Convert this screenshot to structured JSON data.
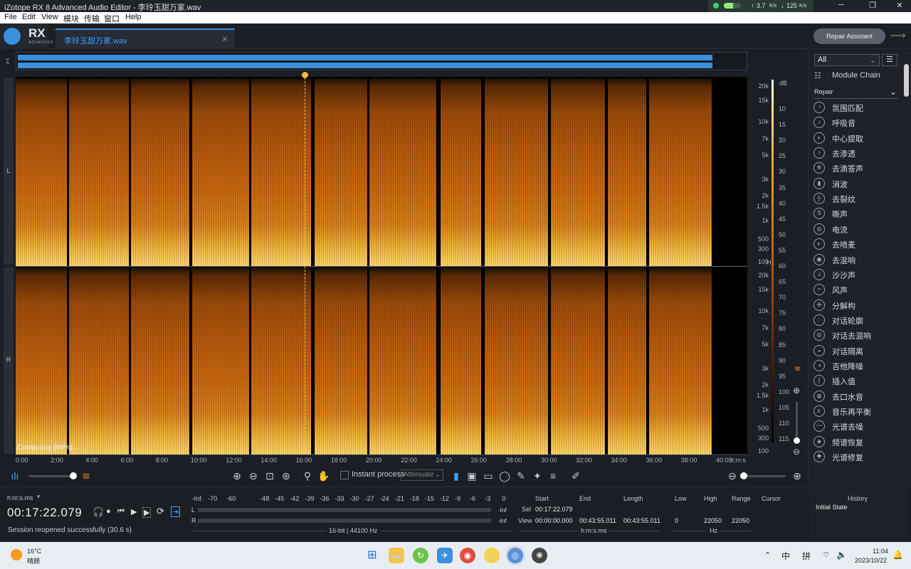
{
  "window": {
    "title": "iZotope RX 8 Advanced Audio Editor - 李玲玉甜万家.wav"
  },
  "network": {
    "up": "3.7",
    "up_unit": "K/s",
    "down": "125",
    "down_unit": "K/s",
    "up_arrow": "↑",
    "down_arrow": "↓"
  },
  "menu": {
    "file": "File",
    "edit": "Edit",
    "view": "View",
    "modules": "模块",
    "transport": "传输",
    "window": "窗口",
    "help": "Help"
  },
  "logo": {
    "rx": "RX",
    "sub": "ADVANCED"
  },
  "tab": {
    "filename": "李玲玉甜万家.wav",
    "close": "×"
  },
  "header": {
    "repair_assistant": "Repair Assistant"
  },
  "channels": {
    "left": "L",
    "right": "R"
  },
  "freq_axis": {
    "labels": [
      "20k",
      "15k",
      "10k",
      "7k",
      "5k",
      "3k",
      "2k",
      "1.5k",
      "1k",
      "500",
      "300",
      "100"
    ],
    "unit": "Hz"
  },
  "db_axis": {
    "unit": "dB",
    "labels": [
      "10",
      "15",
      "20",
      "25",
      "30",
      "35",
      "40",
      "45",
      "50",
      "55",
      "60",
      "65",
      "70",
      "75",
      "80",
      "85",
      "90",
      "95",
      "100",
      "105",
      "110",
      "115"
    ]
  },
  "time_axis": {
    "labels": [
      "0:00",
      "2:00",
      "4:00",
      "6:00",
      "8:00",
      "10:00",
      "12:00",
      "14:00",
      "16:00",
      "18:00",
      "20:00",
      "22:00",
      "24:00",
      "26:00",
      "28:00",
      "30:00",
      "32:00",
      "34:00",
      "36:00",
      "38:00",
      "40:00"
    ],
    "unit": "h:m:s"
  },
  "status_overlay": "Computing (99%)...",
  "toolbar": {
    "instant_process": "Instant process",
    "attenuate": "Attenuate"
  },
  "modules_panel": {
    "filter": "All",
    "module_chain": "Module Chain",
    "category": "Repair",
    "items": [
      "氛围匹配",
      "呼吸音",
      "中心提取",
      "去渗透",
      "去滴答声",
      "消波",
      "去裂纹",
      "嘶声",
      "电流",
      "去喷麦",
      "去混响",
      "沙沙声",
      "风声",
      "分解构",
      "对话轮廓",
      "对话去混响",
      "对话隔离",
      "吉他降噪",
      "插入值",
      "去口水音",
      "音乐再平衡",
      "光谱去噪",
      "频谱恢复",
      "光谱修复"
    ]
  },
  "transport": {
    "timecode_format": "h:m:s.ms",
    "timecode": "00:17:22.079",
    "session_msg": "Session reopened successfully (30.6 s)"
  },
  "meter": {
    "scale": [
      "-Inf.",
      "-70",
      "-60",
      "-48",
      "-45",
      "-42",
      "-39",
      "-36",
      "-33",
      "-30",
      "-27",
      "-24",
      "-21",
      "-18",
      "-15",
      "-12",
      "-9",
      "-6",
      "-3",
      "0"
    ],
    "l_label": "L",
    "r_label": "R",
    "l_peak": "-Inf",
    "r_peak": "-Inf",
    "format": "16-bit | 44100 Hz"
  },
  "selection": {
    "start_h": "Start",
    "end_h": "End",
    "length_h": "Length",
    "sel_label": "Sel",
    "view_label": "View",
    "sel_start": "00:17:22.079",
    "view_start": "00:00:00.000",
    "view_end": "00:43:55.011",
    "view_length": "00:43:55.011",
    "time_unit": "h:m:s.ms",
    "low_h": "Low",
    "high_h": "High",
    "range_h": "Range",
    "cursor_h": "Cursor",
    "low": "0",
    "high": "22050",
    "range": "22050",
    "freq_unit": "Hz"
  },
  "history": {
    "title": "History",
    "initial": "Initial State"
  },
  "taskbar": {
    "temp": "16°C",
    "weather": "晴朗",
    "ime1": "中",
    "ime2": "拼",
    "time": "11:04",
    "date": "2023/10/22"
  }
}
